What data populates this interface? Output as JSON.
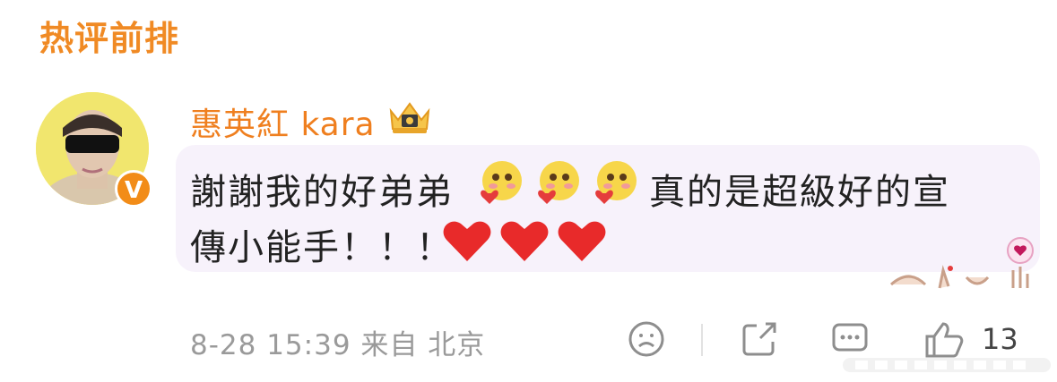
{
  "section": {
    "title": "热评前排"
  },
  "comment": {
    "username": "惠英紅 kara",
    "line1_text_a": "謝謝我的好弟弟",
    "line1_text_b": "真的是超級好的宣",
    "line2_text": "傳小能手！！！",
    "emojis": [
      "blush-heart-emoji",
      "blush-heart-emoji",
      "blush-heart-emoji"
    ],
    "hearts": [
      "red-heart",
      "red-heart",
      "red-heart"
    ],
    "timestamp": "8-28 15:39",
    "location": "来自 北京",
    "like_count": "13"
  },
  "colors": {
    "accent": "#f08a24",
    "username": "#ef7f1f",
    "bubble": "#f7f2fb",
    "heart": "#e82a2a",
    "meta": "#9a9a9a"
  }
}
